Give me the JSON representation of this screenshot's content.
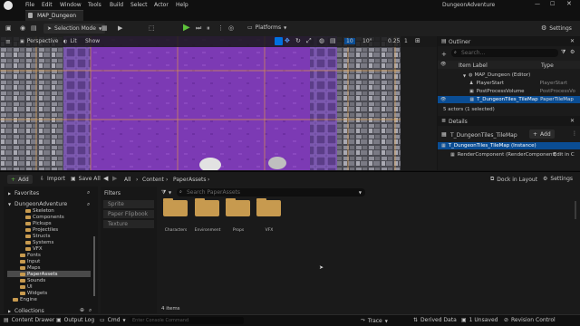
{
  "app": {
    "title": "DungeonAdventure",
    "menu": [
      "File",
      "Edit",
      "Window",
      "Tools",
      "Build",
      "Select",
      "Actor",
      "Help"
    ]
  },
  "level_tab": {
    "label": "MAP_Dungeon"
  },
  "toolbar": {
    "selection_mode": "Selection Mode",
    "platforms": "Platforms",
    "settings": "Settings"
  },
  "viewport": {
    "perspective": "Perspective",
    "lit": "Lit",
    "show": "Show",
    "grid_snap": "10",
    "rotate_snap": "10°",
    "scale_snap": "0.25",
    "camera_speed": "1"
  },
  "outliner": {
    "tab": "Outliner",
    "search_placeholder": "Search...",
    "col_label": "Item Label",
    "col_type": "Type",
    "items": [
      {
        "label": "MAP_Dungeon (Editor)",
        "type": ""
      },
      {
        "label": "PlayerStart",
        "type": "PlayerStart"
      },
      {
        "label": "PostProcessVolume",
        "type": "PostProcessVo"
      },
      {
        "label": "T_DungeonTiles_TileMap",
        "type": "PaperTileMap"
      }
    ],
    "status": "5 actors (1 selected)"
  },
  "details": {
    "tab": "Details",
    "actor": "T_DungeonTiles_TileMap",
    "add": "Add",
    "instance": "T_DungeonTiles_TileMap (Instance)",
    "component": "RenderComponent (RenderComponent)",
    "edit": "Edit in C"
  },
  "content_browser": {
    "add": "Add",
    "import": "Import",
    "save_all": "Save All",
    "breadcrumb": [
      "All",
      "Content",
      "PaperAssets"
    ],
    "dock": "Dock in Layout",
    "settings": "Settings",
    "favorites": "Favorites",
    "project": "DungeonAdventure",
    "tree": [
      "Skeleton",
      "Components",
      "Pickups",
      "Projectiles",
      "Structs",
      "Systems",
      "VFX",
      "Fonts",
      "Input",
      "Maps",
      "PaperAssets",
      "Sounds",
      "UI",
      "Widgets",
      "Engine"
    ],
    "collections": "Collections",
    "filters": "Filters",
    "filter_items": [
      "Sprite",
      "Paper Flipbook",
      "Texture"
    ],
    "search_placeholder": "Search PaperAssets",
    "assets": [
      "Characters",
      "Environment",
      "Props",
      "VFX"
    ],
    "count": "4 items"
  },
  "status_bar": {
    "content_drawer": "Content Drawer",
    "output_log": "Output Log",
    "cmd": "Cmd",
    "cmd_placeholder": "Enter Console Command",
    "trace": "Trace",
    "derived_data": "Derived Data",
    "unsaved": "1 Unsaved",
    "revision_control": "Revision Control"
  },
  "colors": {
    "accent": "#0070e0",
    "selected": "#0a4d94",
    "folder": "#c79a4f",
    "tilemap": "#7d3fb5",
    "play": "#5ec23b"
  }
}
